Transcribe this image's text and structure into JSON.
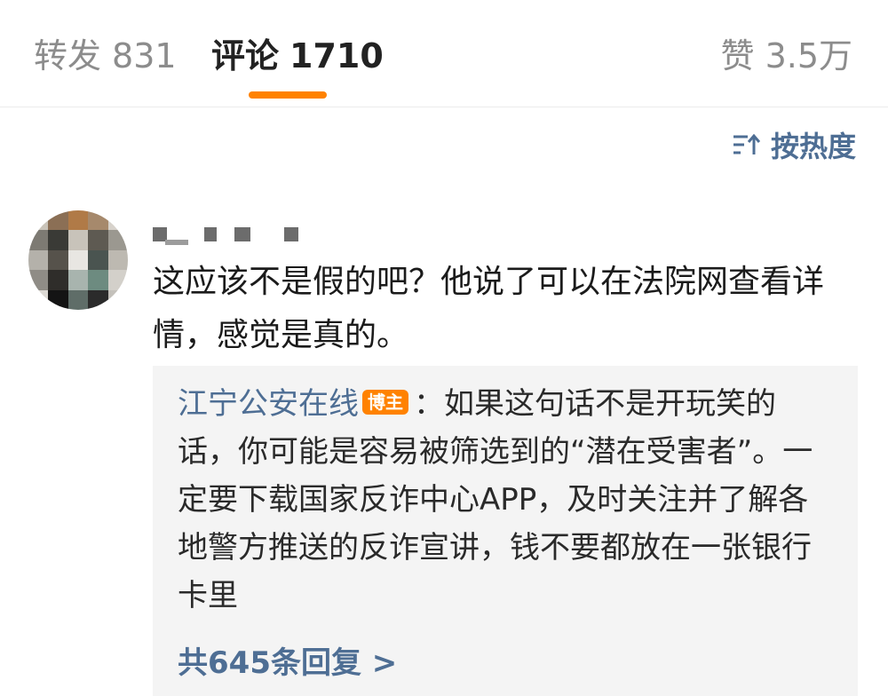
{
  "tabs": {
    "repost": {
      "label": "转发",
      "count": "831"
    },
    "comments": {
      "label": "评论",
      "count": "1710"
    },
    "likes": {
      "label": "赞",
      "count": "3.5万"
    }
  },
  "sort": {
    "label": "按热度",
    "icon": "sort-icon"
  },
  "comment": {
    "text": "这应该不是假的吧？他说了可以在法院网查看详情，感觉是真的。"
  },
  "reply": {
    "author": "江宁公安在线",
    "badge": "博主",
    "separator": "：",
    "text": "如果这句话不是开玩笑的话，你可能是容易被筛选到的“潜在受害者”。一定要下载国家反诈中心APP，及时关注并了解各地警方推送的反诈宣讲，钱不要都放在一张银行卡里",
    "more_label": "共645条回复 >"
  },
  "colors": {
    "accent": "#ff8200",
    "link": "#4e6e94",
    "reply_bg": "#f4f4f4"
  }
}
